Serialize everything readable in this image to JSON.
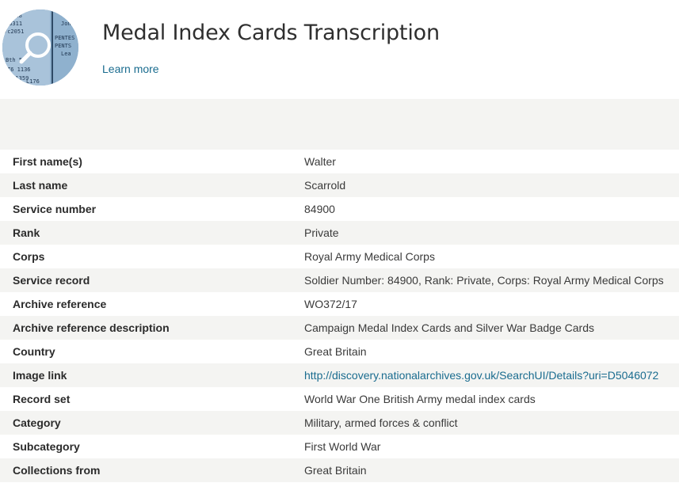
{
  "header": {
    "title": "Medal Index Cards Transcription",
    "learn_more": "Learn more",
    "logo_texts": [
      "1518",
      "43311",
      "7c2051",
      "PENTES",
      "PENTS",
      "Bth 5",
      "T6 1136",
      "P41359",
      "L176",
      "Jon",
      "Lea"
    ]
  },
  "records": [
    {
      "label": "First name(s)",
      "value": "Walter"
    },
    {
      "label": "Last name",
      "value": "Scarrold"
    },
    {
      "label": "Service number",
      "value": "84900"
    },
    {
      "label": "Rank",
      "value": "Private"
    },
    {
      "label": "Corps",
      "value": "Royal Army Medical Corps"
    },
    {
      "label": "Service record",
      "value": "Soldier Number: 84900, Rank: Private, Corps: Royal Army Medical Corps"
    },
    {
      "label": "Archive reference",
      "value": "WO372/17"
    },
    {
      "label": "Archive reference description",
      "value": "Campaign Medal Index Cards and Silver War Badge Cards"
    },
    {
      "label": "Country",
      "value": "Great Britain"
    },
    {
      "label": "Image link",
      "value": "http://discovery.nationalarchives.gov.uk/SearchUI/Details?uri=D5046072",
      "is_link": true
    },
    {
      "label": "Record set",
      "value": "World War One British Army medal index cards"
    },
    {
      "label": "Category",
      "value": "Military, armed forces & conflict"
    },
    {
      "label": "Subcategory",
      "value": "First World War"
    },
    {
      "label": "Collections from",
      "value": "Great Britain"
    }
  ],
  "colors": {
    "link": "#1a6c8f",
    "stripe": "#f4f4f2",
    "logo_bg": "#8fb1ce"
  },
  "icons": {
    "logo": "magnifier-over-document-icon"
  }
}
